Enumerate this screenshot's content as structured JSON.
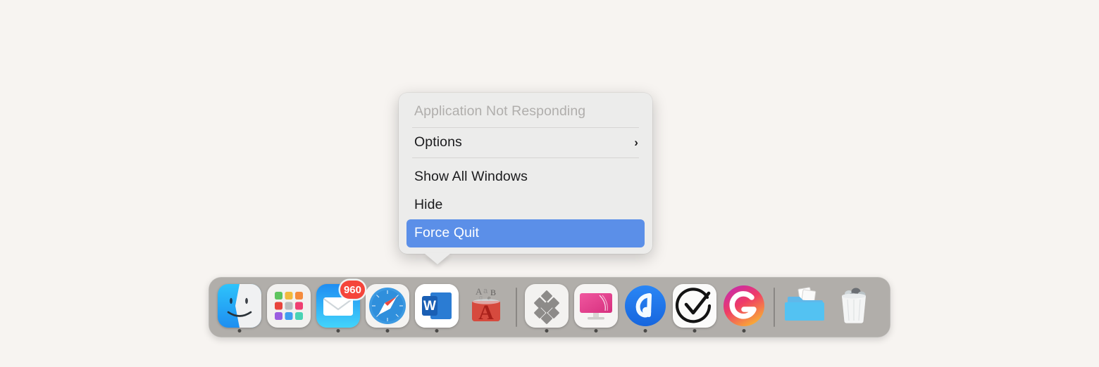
{
  "desktop": {
    "background_color": "#f7f4f1"
  },
  "context_menu": {
    "header": "Application Not Responding",
    "items": [
      {
        "label": "Options",
        "submenu_indicator": "›",
        "highlighted": false
      },
      {
        "label": "Show All Windows",
        "highlighted": false
      },
      {
        "label": "Hide",
        "highlighted": false
      },
      {
        "label": "Force Quit",
        "highlighted": true
      }
    ],
    "highlight_color": "#5b8fe8",
    "background_color": "#ececeb"
  },
  "dock": {
    "background_color": "#aaa7a4",
    "items": [
      {
        "name": "Finder",
        "icon": "finder-icon",
        "running": true,
        "badge": null
      },
      {
        "name": "Launchpad",
        "icon": "launchpad-icon",
        "running": false,
        "badge": null
      },
      {
        "name": "Mail",
        "icon": "mail-icon",
        "running": true,
        "badge": "960"
      },
      {
        "name": "Safari",
        "icon": "safari-icon",
        "running": true,
        "badge": null
      },
      {
        "name": "Microsoft Word",
        "icon": "word-icon",
        "running": true,
        "badge": null
      },
      {
        "name": "Font Book",
        "icon": "font-book-icon",
        "running": false,
        "badge": null
      },
      {
        "name": "Dropbox",
        "icon": "dropbox-icon",
        "running": true,
        "badge": null
      },
      {
        "name": "CleanMyMac",
        "icon": "imac-display-icon",
        "running": true,
        "badge": null
      },
      {
        "name": "AnyDesk",
        "icon": "anydesk-icon",
        "running": true,
        "badge": null
      },
      {
        "name": "TickTick",
        "icon": "checkmark-circle-icon",
        "running": true,
        "badge": null
      },
      {
        "name": "Grammarly",
        "icon": "grammarly-icon",
        "running": true,
        "badge": null
      },
      {
        "name": "Downloads",
        "icon": "downloads-folder-icon",
        "running": false,
        "badge": null
      },
      {
        "name": "Trash",
        "icon": "trash-full-icon",
        "running": false,
        "badge": null
      }
    ],
    "separator_after_indices": [
      5,
      10
    ]
  }
}
